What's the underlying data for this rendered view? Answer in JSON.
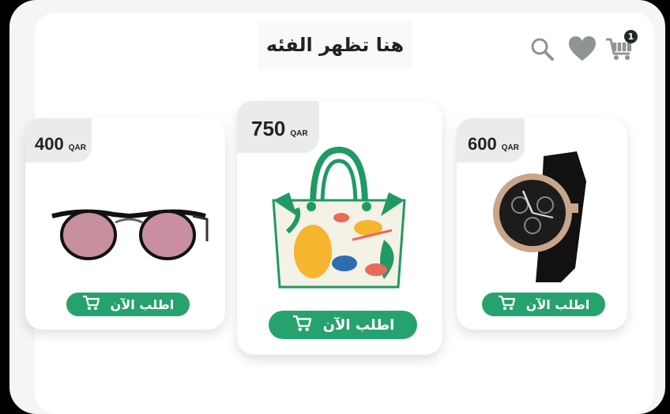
{
  "header": {
    "title": "هنا تظهر الفئه",
    "cart_count": "1"
  },
  "icons": {
    "search": "search-icon",
    "favorites": "heart-icon",
    "cart": "cart-icon"
  },
  "colors": {
    "accent": "#26a26f",
    "price_tag_bg": "#eaeceb",
    "badge_bg": "#1d2b2a"
  },
  "products": [
    {
      "name_icon": "sunglasses-image",
      "price": "400",
      "currency": "QAR",
      "order_label": "اطلب الآن"
    },
    {
      "name_icon": "handbag-image",
      "price": "750",
      "currency": "QAR",
      "order_label": "اطلب الآن"
    },
    {
      "name_icon": "watch-image",
      "price": "600",
      "currency": "QAR",
      "order_label": "اطلب الآن"
    }
  ]
}
